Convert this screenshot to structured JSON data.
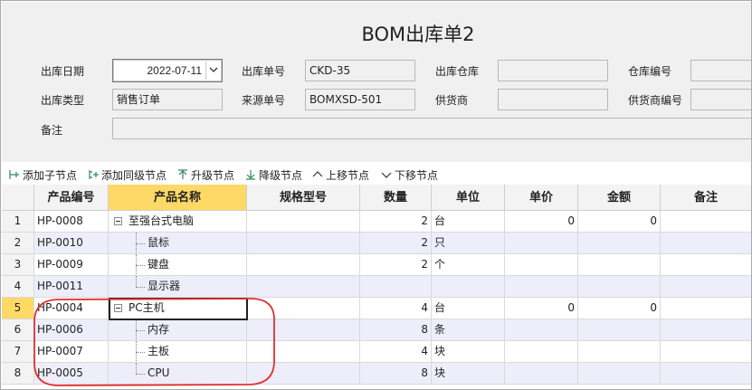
{
  "form": {
    "title": "BOM出库单2",
    "labels": {
      "out_date": "出库日期",
      "out_no": "出库单号",
      "out_warehouse": "出库仓库",
      "warehouse_no": "仓库编号",
      "out_type": "出库类型",
      "source_no": "来源单号",
      "supplier": "供货商",
      "supplier_no": "供货商编号",
      "remark": "备注"
    },
    "values": {
      "out_date": "2022-07-11",
      "out_no": "CKD-35",
      "out_warehouse": "",
      "warehouse_no": "",
      "out_type": "销售订单",
      "source_no": "BOMXSD-501",
      "supplier": "",
      "supplier_no": "",
      "remark": ""
    }
  },
  "toolbar": {
    "add_child": "添加子节点",
    "add_sibling": "添加同级节点",
    "upgrade": "升级节点",
    "downgrade": "降级节点",
    "move_up": "上移节点",
    "move_down": "下移节点"
  },
  "table": {
    "columns": [
      "产品编号",
      "产品名称",
      "规格型号",
      "数量",
      "单位",
      "单价",
      "金额",
      "备注"
    ],
    "rows": [
      {
        "num": "1",
        "code": "HP-0008",
        "name": "至强台式电脑",
        "spec": "",
        "qty": "2",
        "unit": "台",
        "price": "0",
        "amount": "0",
        "remark": ""
      },
      {
        "num": "2",
        "code": "HP-0010",
        "name": "鼠标",
        "spec": "",
        "qty": "2",
        "unit": "只",
        "price": "",
        "amount": "",
        "remark": ""
      },
      {
        "num": "3",
        "code": "HP-0009",
        "name": "键盘",
        "spec": "",
        "qty": "2",
        "unit": "个",
        "price": "",
        "amount": "",
        "remark": ""
      },
      {
        "num": "4",
        "code": "HP-0011",
        "name": "显示器",
        "spec": "",
        "qty": "",
        "unit": "",
        "price": "",
        "amount": "",
        "remark": ""
      },
      {
        "num": "5",
        "code": "HP-0004",
        "name": "PC主机",
        "spec": "",
        "qty": "4",
        "unit": "台",
        "price": "0",
        "amount": "0",
        "remark": ""
      },
      {
        "num": "6",
        "code": "HP-0006",
        "name": "内存",
        "spec": "",
        "qty": "8",
        "unit": "条",
        "price": "",
        "amount": "",
        "remark": ""
      },
      {
        "num": "7",
        "code": "HP-0007",
        "name": "主板",
        "spec": "",
        "qty": "4",
        "unit": "块",
        "price": "",
        "amount": "",
        "remark": ""
      },
      {
        "num": "8",
        "code": "HP-0005",
        "name": "CPU",
        "spec": "",
        "qty": "8",
        "unit": "块",
        "price": "",
        "amount": "",
        "remark": ""
      }
    ]
  },
  "colors": {
    "selected_header": "#ffd966",
    "alt_row": "#eeeefa",
    "annotation": "#e03030",
    "toolbar_icon": "#2e8b57"
  }
}
